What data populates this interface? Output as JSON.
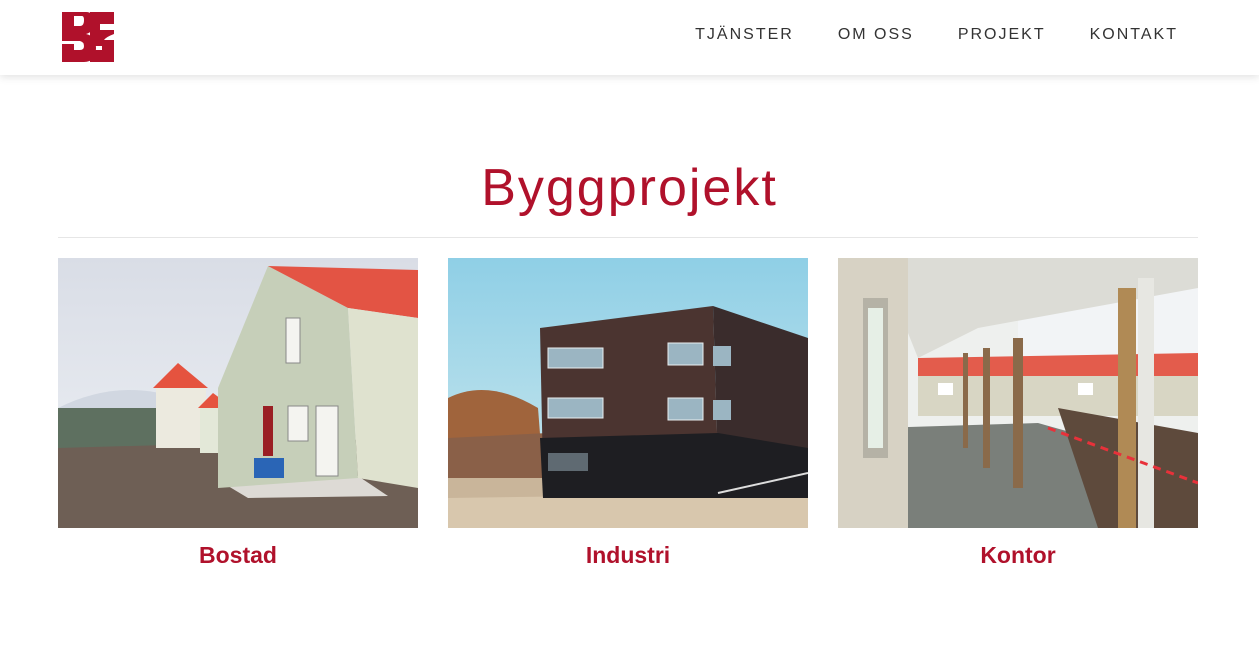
{
  "header": {
    "nav": [
      {
        "label": "TJÄNSTER"
      },
      {
        "label": "OM OSS"
      },
      {
        "label": "PROJEKT"
      },
      {
        "label": "KONTAKT"
      }
    ]
  },
  "main": {
    "title": "Byggprojekt",
    "projects": [
      {
        "label": "Bostad",
        "icon": "house-photo"
      },
      {
        "label": "Industri",
        "icon": "industrial-building-photo"
      },
      {
        "label": "Kontor",
        "icon": "office-veranda-photo"
      }
    ]
  },
  "colors": {
    "accent": "#b0112b",
    "nav_text": "#333333"
  }
}
